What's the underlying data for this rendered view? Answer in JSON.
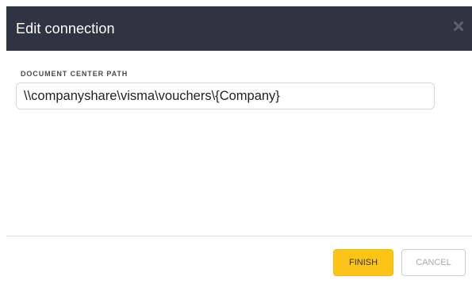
{
  "dialog": {
    "title": "Edit connection",
    "close_icon": "close-icon"
  },
  "form": {
    "path_label": "DOCUMENT CENTER PATH",
    "path_value": "\\\\companyshare\\visma\\vouchers\\{Company}"
  },
  "footer": {
    "finish_label": "FINISH",
    "cancel_label": "CANCEL"
  },
  "colors": {
    "header_bg": "#2e3441",
    "finish_bg": "#fcc419",
    "cancel_text": "#a9a9a9"
  }
}
